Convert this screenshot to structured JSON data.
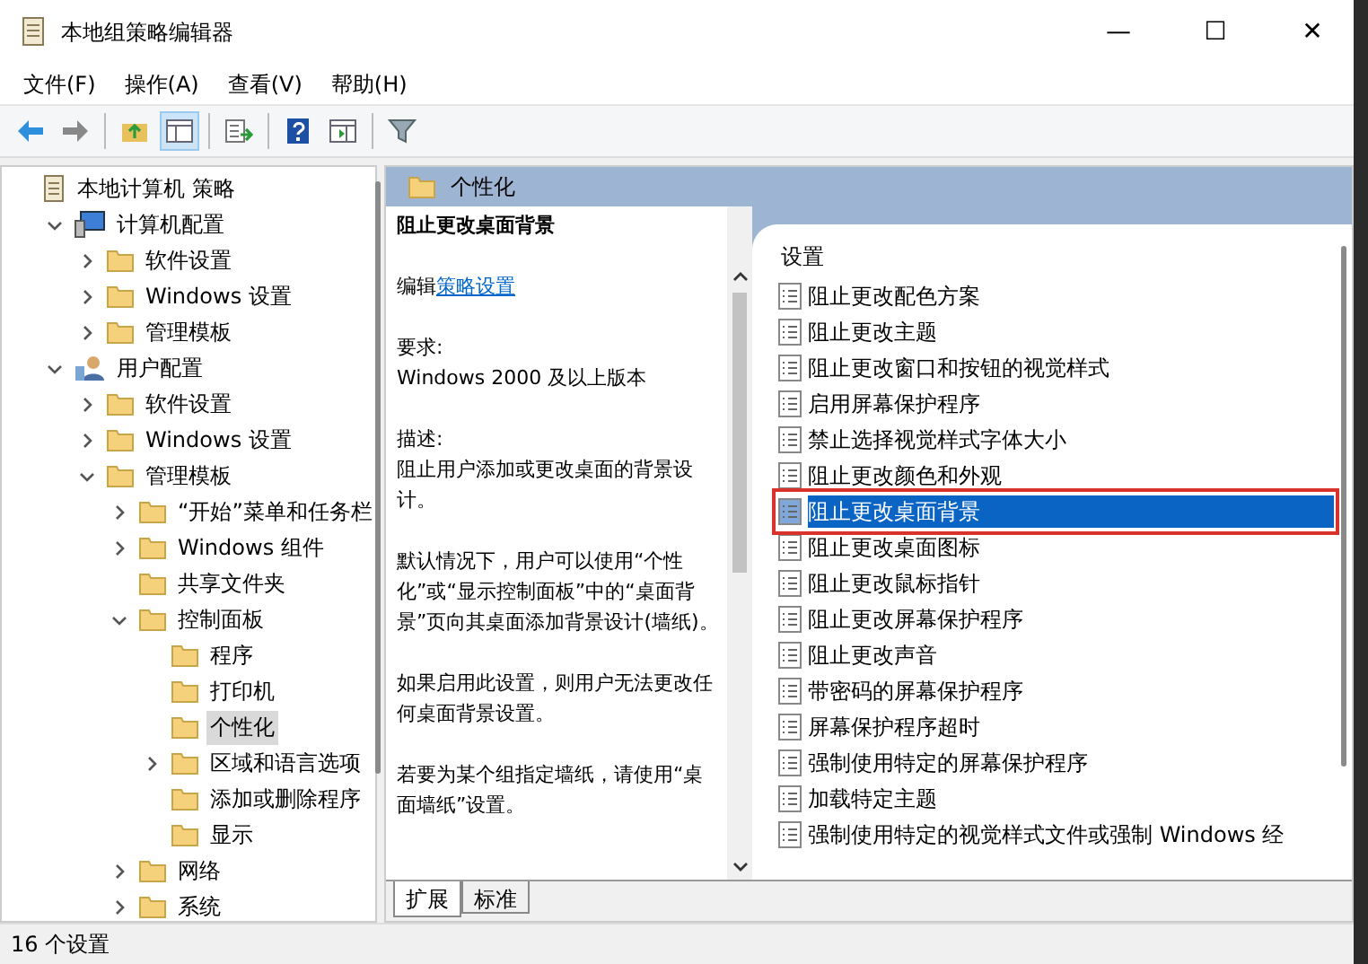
{
  "window": {
    "title": "本地组策略编辑器",
    "controls": [
      "—",
      "☐",
      "✕"
    ]
  },
  "menu": [
    "文件(F)",
    "操作(A)",
    "查看(V)",
    "帮助(H)"
  ],
  "toolbar": [
    {
      "kind": "back"
    },
    {
      "kind": "forward"
    },
    {
      "kind": "sep"
    },
    {
      "kind": "up"
    },
    {
      "kind": "pane",
      "selected": true
    },
    {
      "kind": "sep"
    },
    {
      "kind": "export"
    },
    {
      "kind": "sep"
    },
    {
      "kind": "help"
    },
    {
      "kind": "view"
    },
    {
      "kind": "sep"
    },
    {
      "kind": "filter"
    }
  ],
  "tree": [
    {
      "label": "本地计算机 策略",
      "kind": "policy",
      "children": [
        {
          "label": "计算机配置",
          "kind": "computer",
          "expanded": true,
          "children": [
            {
              "label": "软件设置",
              "kind": "folder",
              "expanded": false
            },
            {
              "label": "Windows 设置",
              "kind": "folder",
              "expanded": false
            },
            {
              "label": "管理模板",
              "kind": "folder",
              "expanded": false
            }
          ]
        },
        {
          "label": "用户配置",
          "kind": "user",
          "expanded": true,
          "children": [
            {
              "label": "软件设置",
              "kind": "folder",
              "expanded": false
            },
            {
              "label": "Windows 设置",
              "kind": "folder",
              "expanded": false
            },
            {
              "label": "管理模板",
              "kind": "folder",
              "expanded": true,
              "children": [
                {
                  "label": "“开始”菜单和任务栏",
                  "kind": "folder",
                  "expanded": false
                },
                {
                  "label": "Windows 组件",
                  "kind": "folder",
                  "expanded": false
                },
                {
                  "label": "共享文件夹",
                  "kind": "folder"
                },
                {
                  "label": "控制面板",
                  "kind": "folder",
                  "expanded": true,
                  "children": [
                    {
                      "label": "程序",
                      "kind": "folder"
                    },
                    {
                      "label": "打印机",
                      "kind": "folder"
                    },
                    {
                      "label": "个性化",
                      "kind": "folder",
                      "selected": true
                    },
                    {
                      "label": "区域和语言选项",
                      "kind": "folder",
                      "expanded": false
                    },
                    {
                      "label": "添加或删除程序",
                      "kind": "folder"
                    },
                    {
                      "label": "显示",
                      "kind": "folder"
                    }
                  ]
                },
                {
                  "label": "网络",
                  "kind": "folder",
                  "expanded": false
                },
                {
                  "label": "系统",
                  "kind": "folder",
                  "expanded": false
                }
              ]
            }
          ]
        }
      ]
    }
  ],
  "header": {
    "title": "个性化"
  },
  "description": {
    "title": "阻止更改桌面背景",
    "edit_prefix": "编辑",
    "edit_link": "策略设置",
    "requirements_label": "要求:",
    "requirements": "Windows 2000 及以上版本",
    "description_label": "描述:",
    "paragraphs": [
      "阻止用户添加或更改桌面的背景设计。",
      "默认情况下，用户可以使用“个性化”或“显示控制面板”中的“桌面背景”页向其桌面添加背景设计(墙纸)。",
      "如果启用此设置，则用户无法更改任何桌面背景设置。",
      "若要为某个组指定墙纸，请使用“桌面墙纸”设置。"
    ]
  },
  "settings": {
    "column": "设置",
    "items": [
      {
        "label": "阻止更改配色方案",
        "selected": false,
        "outlined": false
      },
      {
        "label": "阻止更改主题",
        "selected": false,
        "outlined": false
      },
      {
        "label": "阻止更改窗口和按钮的视觉样式",
        "selected": false,
        "outlined": false
      },
      {
        "label": "启用屏幕保护程序",
        "selected": false,
        "outlined": false
      },
      {
        "label": "禁止选择视觉样式字体大小",
        "selected": false,
        "outlined": false
      },
      {
        "label": "阻止更改颜色和外观",
        "selected": false,
        "outlined": false
      },
      {
        "label": "阻止更改桌面背景",
        "selected": true,
        "outlined": true
      },
      {
        "label": "阻止更改桌面图标",
        "selected": false,
        "outlined": false
      },
      {
        "label": "阻止更改鼠标指针",
        "selected": false,
        "outlined": false
      },
      {
        "label": "阻止更改屏幕保护程序",
        "selected": false,
        "outlined": false
      },
      {
        "label": "阻止更改声音",
        "selected": false,
        "outlined": false
      },
      {
        "label": "带密码的屏幕保护程序",
        "selected": false,
        "outlined": false
      },
      {
        "label": "屏幕保护程序超时",
        "selected": false,
        "outlined": false
      },
      {
        "label": "强制使用特定的屏幕保护程序",
        "selected": false,
        "outlined": false
      },
      {
        "label": "加载特定主题",
        "selected": false,
        "outlined": false
      },
      {
        "label": "强制使用特定的视觉样式文件或强制 Windows 经",
        "selected": false,
        "outlined": false
      }
    ]
  },
  "tabs": [
    {
      "label": "扩展",
      "selected": true
    },
    {
      "label": "标准",
      "selected": false
    }
  ],
  "status_bar": "16 个设置"
}
